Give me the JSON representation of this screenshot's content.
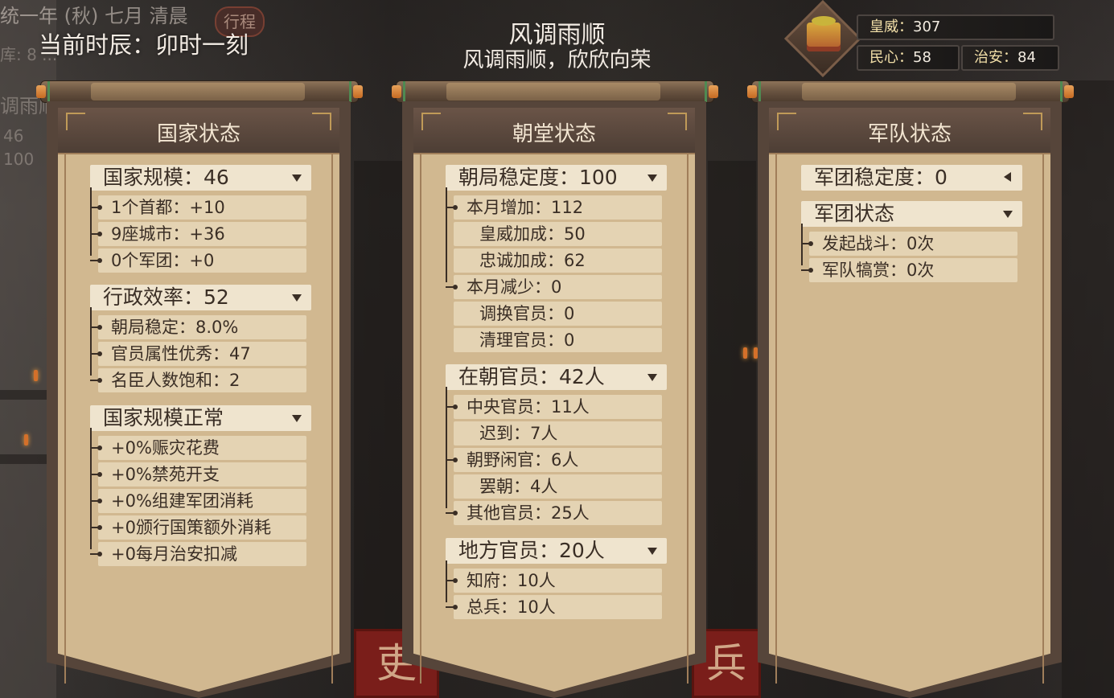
{
  "hud": {
    "date_line": "统一年 (秋) 七月 清晨",
    "date_badge": "行程",
    "time_line": "当前时辰：卯时一刻",
    "ghost_storage": "库: 8 ...",
    "ghost_weather": "调雨顺",
    "ghost_value_1": "46",
    "ghost_value_2": "100"
  },
  "weather": {
    "title": "风调雨顺",
    "subtitle": "风调雨顺，欣欣向荣"
  },
  "stats": {
    "emblem_icon": "treasure-chest-icon",
    "huangwei_label": "皇威：",
    "huangwei_value": "307",
    "minxin_label": "民心：",
    "minxin_value": "58",
    "zhian_label": "治安：",
    "zhian_value": "84"
  },
  "panels": {
    "national": {
      "title": "国家状态",
      "groups": [
        {
          "header": "国家规模：46",
          "rows": [
            "1个首都：+10",
            "9座城市：+36",
            "0个军团：+0"
          ]
        },
        {
          "header": "行政效率：52",
          "rows": [
            "朝局稳定：8.0%",
            "官员属性优秀：47",
            "名臣人数饱和：2"
          ]
        },
        {
          "header": "国家规模正常",
          "rows": [
            "+0%赈灾花费",
            "+0%禁苑开支",
            "+0%组建军团消耗",
            "+0颁行国策额外消耗",
            "+0每月治安扣减"
          ]
        }
      ]
    },
    "court": {
      "title": "朝堂状态",
      "groups": [
        {
          "header": "朝局稳定度：100",
          "rows": [
            "本月增加：112",
            "皇威加成：50",
            "忠诚加成：62",
            "本月减少：0",
            "调换官员：0",
            "清理官员：0"
          ]
        },
        {
          "header": "在朝官员：42人",
          "rows": [
            "中央官员：11人",
            "迟到：7人",
            "朝野闲官：6人",
            "罢朝：4人",
            "其他官员：25人"
          ]
        },
        {
          "header": "地方官员：20人",
          "rows": [
            "知府：10人",
            "总兵：10人"
          ]
        }
      ]
    },
    "army": {
      "title": "军队状态",
      "groups": [
        {
          "header": "军团稳定度：0",
          "rows": []
        },
        {
          "header": "军团状态",
          "rows": [
            "发起战斗：0次",
            "军队犒赏：0次"
          ]
        }
      ]
    }
  },
  "background": {
    "banner_left": "吏",
    "banner_right": "兵"
  }
}
